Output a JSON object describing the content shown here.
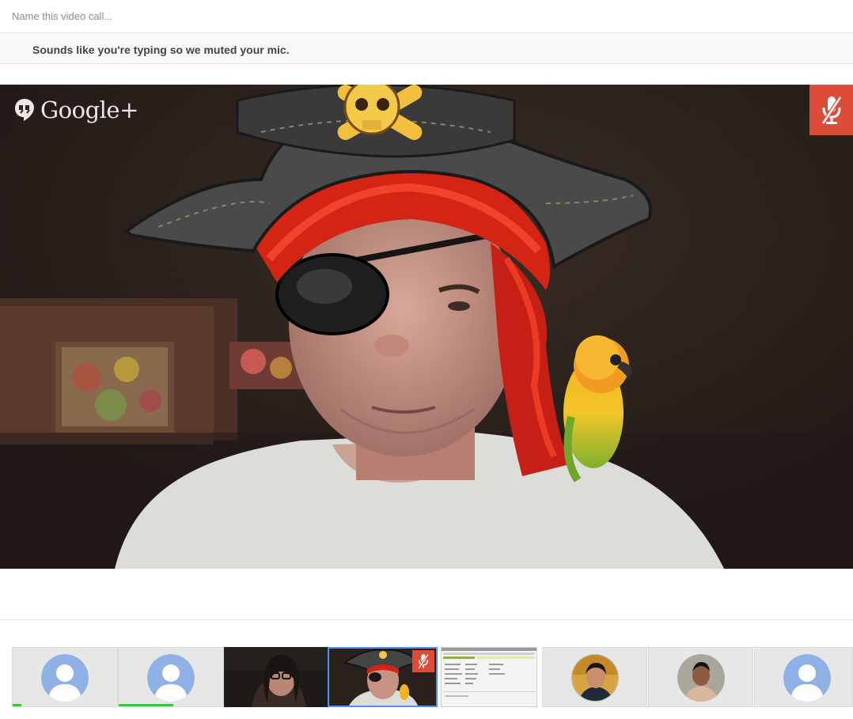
{
  "call": {
    "name_placeholder": "Name this video call...",
    "name_value": ""
  },
  "notice": {
    "text": "Sounds like you're typing so we muted your mic."
  },
  "brand": {
    "logo_text": "Google+",
    "icon": "hangouts-quote-icon"
  },
  "main_video": {
    "mic_status": "muted",
    "mic_icon": "mic-muted-icon",
    "effects": [
      "pirate-hat",
      "eye-patch",
      "red-bandana",
      "parrot"
    ]
  },
  "participants": [
    {
      "type": "default-avatar",
      "speaking_level": 0.08
    },
    {
      "type": "default-avatar",
      "speaking_level": 0.52
    },
    {
      "type": "video"
    },
    {
      "type": "video",
      "selected": true,
      "mic_status": "muted"
    },
    {
      "type": "screen-share"
    },
    {
      "type": "photo-avatar"
    },
    {
      "type": "photo-avatar"
    },
    {
      "type": "default-avatar"
    }
  ],
  "colors": {
    "accent_red": "#dd4b39",
    "selected_blue": "#4d90fe",
    "speaking_green": "#39c33f",
    "avatar_blue": "#8fb1e6"
  }
}
